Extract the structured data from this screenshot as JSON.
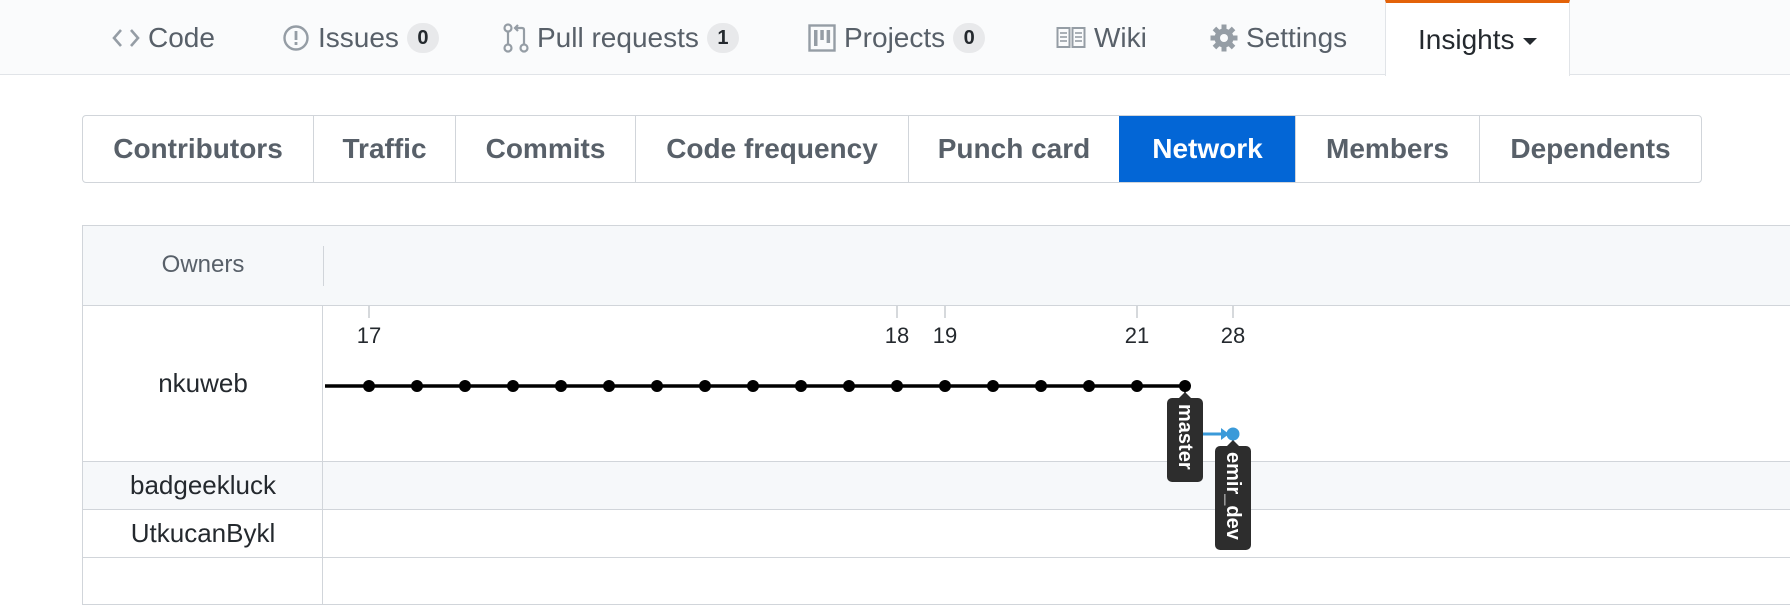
{
  "reponav": {
    "code": {
      "label": "Code",
      "icon": "code-icon"
    },
    "issues": {
      "label": "Issues",
      "count": "0",
      "icon": "issue-opened-icon"
    },
    "pulls": {
      "label": "Pull requests",
      "count": "1",
      "icon": "git-pull-request-icon"
    },
    "projects": {
      "label": "Projects",
      "count": "0",
      "icon": "project-icon"
    },
    "wiki": {
      "label": "Wiki",
      "icon": "book-icon"
    },
    "settings": {
      "label": "Settings",
      "icon": "gear-icon"
    },
    "insights": {
      "label": "Insights",
      "icon": "caret-down-icon",
      "selected": true
    }
  },
  "subnav": {
    "items": [
      {
        "label": "Contributors"
      },
      {
        "label": "Traffic"
      },
      {
        "label": "Commits"
      },
      {
        "label": "Code frequency"
      },
      {
        "label": "Punch card"
      },
      {
        "label": "Network",
        "selected": true
      },
      {
        "label": "Members"
      },
      {
        "label": "Dependents"
      }
    ]
  },
  "network": {
    "owners_label": "Owners",
    "owners": [
      {
        "name": "nkuweb"
      },
      {
        "name": "badgeekluck"
      },
      {
        "name": "UtkucanBykl"
      }
    ],
    "date_labels": [
      "17",
      "18",
      "19",
      "21",
      "28"
    ],
    "master_commits": 18,
    "branches": [
      {
        "name": "master",
        "color": "#000000"
      },
      {
        "name": "emir_dev",
        "color": "#3a9ad9"
      }
    ]
  },
  "colors": {
    "accent": "#0366d6",
    "selected_tab_border": "#e36209",
    "branch_fork": "#3a9ad9",
    "label_bg": "#2d2d2d"
  }
}
